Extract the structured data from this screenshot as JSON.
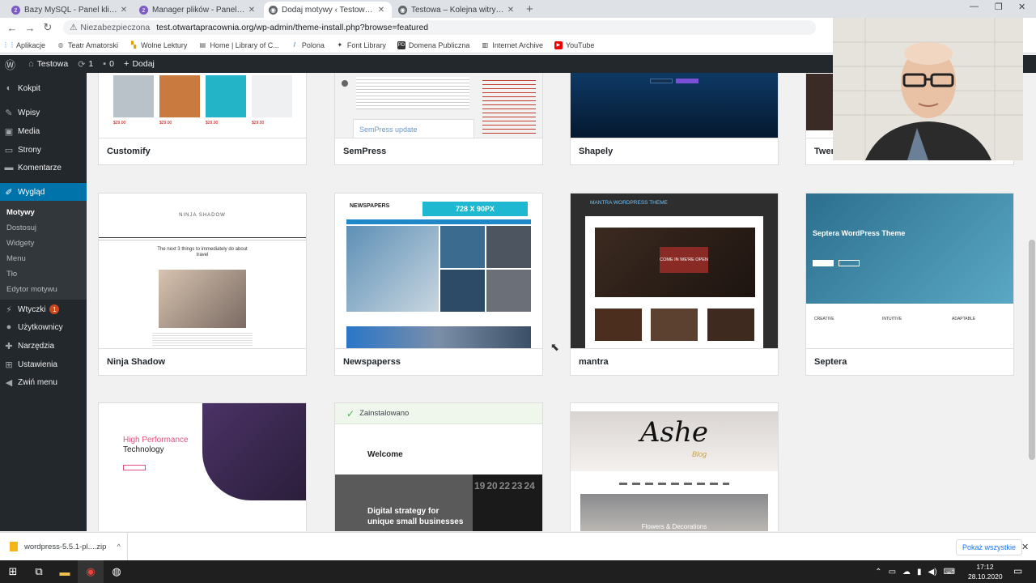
{
  "browser": {
    "tabs": [
      {
        "title": "Bazy MySQL - Panel klienta zenbo",
        "fav_color": "#7c5cc4",
        "fav_glyph": "z",
        "active": false
      },
      {
        "title": "Manager plików - Panel klienta ze",
        "fav_color": "#7c5cc4",
        "fav_glyph": "z",
        "active": false
      },
      {
        "title": "Dodaj motywy ‹ Testowa — Word",
        "fav_color": "#5f6368",
        "fav_glyph": "◉",
        "active": true
      },
      {
        "title": "Testowa – Kolejna witryna oparta",
        "fav_color": "#5f6368",
        "fav_glyph": "◉",
        "active": false
      }
    ],
    "tab_close": "✕",
    "new_tab": "+",
    "window_controls": {
      "minimize": "—",
      "restore": "❐",
      "close": "✕"
    },
    "nav": {
      "back": "←",
      "forward": "→",
      "reload": "↻"
    },
    "address": {
      "security": "Niezabezpieczona",
      "url": "test.otwartapracownia.org/wp-admin/theme-install.php?browse=featured"
    },
    "bookmarks": [
      {
        "label": "Aplikacje",
        "icon": "apps-icon",
        "glyph": "⋮⋮",
        "color": "#1a73e8"
      },
      {
        "label": "Teatr Amatorski",
        "icon": "globe-icon",
        "glyph": "◍",
        "color": "#777"
      },
      {
        "label": "Wolne Lektury",
        "icon": "book-icon",
        "glyph": "▚",
        "color": "#e0a100"
      },
      {
        "label": "Home | Library of C...",
        "icon": "library-icon",
        "glyph": "▤",
        "color": "#555"
      },
      {
        "label": "Polona",
        "icon": "polona-icon",
        "glyph": "/",
        "color": "#1565c0"
      },
      {
        "label": "Font Library",
        "icon": "font-icon",
        "glyph": "✦",
        "color": "#333"
      },
      {
        "label": "Domena Publiczna",
        "icon": "domain-icon",
        "glyph": "PD",
        "color": "#333"
      },
      {
        "label": "Internet Archive",
        "icon": "archive-icon",
        "glyph": "▥",
        "color": "#333"
      },
      {
        "label": "YouTube",
        "icon": "youtube-icon",
        "glyph": "▶",
        "color": "#e00"
      }
    ]
  },
  "adminbar": {
    "wp_logo": "Ⓦ",
    "site_icon": "⌂",
    "site": "Testowa",
    "updates_icon": "⟳",
    "updates": "1",
    "comments_icon": "▪",
    "comments": "0",
    "add_icon": "+",
    "add": "Dodaj"
  },
  "sidebar": {
    "items": [
      {
        "label": "Kokpit",
        "glyph": "◐",
        "icon": "dashboard-icon"
      },
      {
        "label": "Wpisy",
        "glyph": "✎",
        "icon": "pin-icon"
      },
      {
        "label": "Media",
        "glyph": "▣",
        "icon": "media-icon"
      },
      {
        "label": "Strony",
        "glyph": "▭",
        "icon": "pages-icon"
      },
      {
        "label": "Komentarze",
        "glyph": "▬",
        "icon": "comments-icon"
      },
      {
        "label": "Wygląd",
        "glyph": "✐",
        "icon": "appearance-icon"
      },
      {
        "label": "Wtyczki",
        "glyph": "⚡",
        "icon": "plugins-icon",
        "badge": "1"
      },
      {
        "label": "Użytkownicy",
        "glyph": "●",
        "icon": "users-icon"
      },
      {
        "label": "Narzędzia",
        "glyph": "✚",
        "icon": "tools-icon"
      },
      {
        "label": "Ustawienia",
        "glyph": "⊞",
        "icon": "settings-icon"
      },
      {
        "label": "Zwiń menu",
        "glyph": "◀",
        "icon": "collapse-icon"
      }
    ],
    "submenu": [
      "Motywy",
      "Dostosuj",
      "Widgety",
      "Menu",
      "Tło",
      "Edytor motywu"
    ]
  },
  "themes": [
    {
      "name": "Customify",
      "price": "$29.00"
    },
    {
      "name": "SemPress",
      "headline": "SemPress update"
    },
    {
      "name": "Shapely"
    },
    {
      "name": "Twen"
    },
    {
      "name": "Ninja Shadow",
      "logo": "NINJA SHADOW",
      "headline": "The next 3 things to immediately do about travel"
    },
    {
      "name": "Newspaperss",
      "logo": "NEWSPAPERS",
      "ad": "728 X 90PX"
    },
    {
      "name": "mantra",
      "header": "MANTRA WORDPRESS THEME",
      "sign": "COME IN WE'RE OPEN"
    },
    {
      "name": "Septera",
      "hero": "Septera WordPress Theme",
      "features": [
        "CREATIVE",
        "INTUITIVE",
        "ADAPTABLE"
      ]
    },
    {
      "name": "",
      "hero_line1": "High Performance",
      "hero_line2": "Technology"
    },
    {
      "name": "",
      "installed": "Zainstalowano",
      "welcome": "Welcome",
      "tagline1": "Digital strategy for",
      "tagline2": "unique small businesses",
      "calendar": [
        "19",
        "20",
        "22",
        "23",
        "24"
      ]
    },
    {
      "name": "",
      "logo": "Ashe",
      "logo_sub": "Blog",
      "caption": "Flowers & Decorations"
    }
  ],
  "downloads": {
    "file": "wordpress-5.5.1-pl....zip",
    "show_all": "Pokaż wszystkie",
    "chevron": "^",
    "close": "✕"
  },
  "taskbar": {
    "icons": [
      {
        "name": "windows-start-icon",
        "glyph": "⊞"
      },
      {
        "name": "task-view-icon",
        "glyph": "⧉"
      },
      {
        "name": "file-explorer-icon",
        "glyph": "▬"
      },
      {
        "name": "chrome-icon",
        "glyph": "◉"
      },
      {
        "name": "app-icon",
        "glyph": "◍"
      }
    ],
    "tray_glyphs": [
      "⌃",
      "▭",
      "☁",
      "▮",
      "◀)",
      "⌨"
    ],
    "time": "17:12",
    "date": "28.10.2020"
  }
}
